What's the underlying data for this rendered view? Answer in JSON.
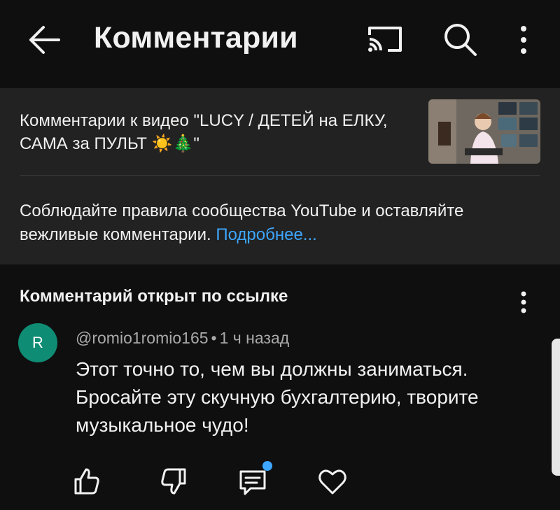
{
  "header": {
    "title": "Комментарии",
    "back_icon": "arrow-left-icon",
    "cast_icon": "cast-icon",
    "search_icon": "search-icon",
    "more_icon": "more-vertical-icon"
  },
  "video_info": {
    "text": "Комментарии к видео \"LUCY /  ДЕТЕЙ на ЕЛКУ, САМА за ПУЛЬТ ☀️🎄\"",
    "thumbnail_icon": "video-thumbnail"
  },
  "guidelines": {
    "text": "Соблюдайте правила сообщества YouTube и оставляйте вежливые комментарии.",
    "link_text": "Подробнее..."
  },
  "linked_comment": {
    "section_title": "Комментарий открыт по ссылке",
    "avatar_letter": "R",
    "avatar_color": "#0f8c74",
    "author": "@romio1romio165",
    "separator": "•",
    "time": "1 ч назад",
    "text": "Этот точно то, чем вы должны заниматься. Бросайте эту скучную бухгалтерию, творите музыкальное чудо!"
  },
  "actions": {
    "like_icon": "thumbs-up-icon",
    "dislike_icon": "thumbs-down-icon",
    "reply_icon": "reply-comment-icon",
    "heart_icon": "heart-icon",
    "notification_dot_color": "#3ea6ff"
  },
  "colors": {
    "background": "#0f0f0f",
    "panel": "#222222",
    "link": "#3ea6ff",
    "secondary_text": "#aaaaaa"
  }
}
